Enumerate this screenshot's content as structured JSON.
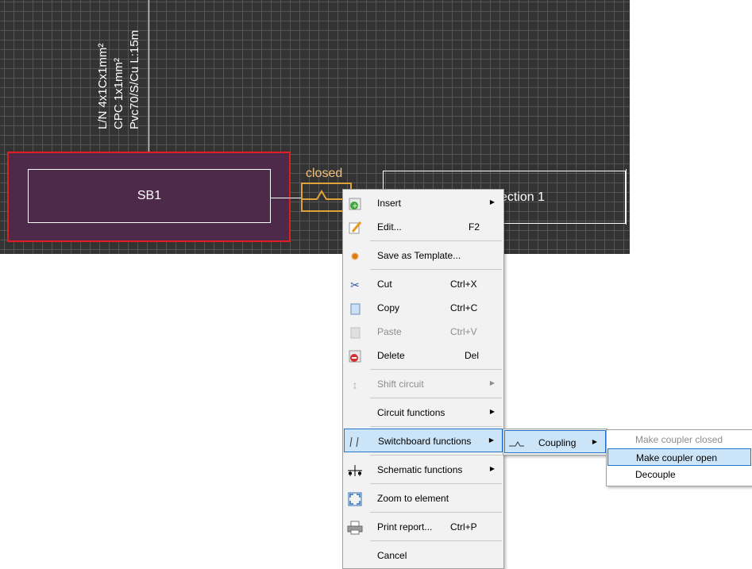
{
  "canvas": {
    "cable_lines": [
      "L/N 4x1Cx1mm²",
      "CPC  1x1mm²",
      "Pvc70/S/Cu L:15m"
    ],
    "switchboard_name": "SB1",
    "coupler_state": "closed",
    "section_name": "ection 1",
    "colors": {
      "background": "#333333",
      "grid": "#555555",
      "selection": "#e21e1e",
      "fill": "#4d2a4a",
      "coupler": "#e0a23a"
    }
  },
  "context_menu": {
    "items": [
      {
        "label": "Insert",
        "shortcut": "",
        "submenu": true,
        "disabled": false,
        "icon": "insert-icon"
      },
      {
        "label": "Edit...",
        "shortcut": "F2",
        "submenu": false,
        "disabled": false,
        "icon": "edit-icon"
      },
      {
        "label": "Save as Template...",
        "shortcut": "",
        "submenu": false,
        "disabled": false,
        "icon": "gear-icon"
      },
      {
        "label": "Cut",
        "shortcut": "Ctrl+X",
        "submenu": false,
        "disabled": false,
        "icon": "scissors-icon"
      },
      {
        "label": "Copy",
        "shortcut": "Ctrl+C",
        "submenu": false,
        "disabled": false,
        "icon": "copy-icon"
      },
      {
        "label": "Paste",
        "shortcut": "Ctrl+V",
        "submenu": false,
        "disabled": true,
        "icon": "paste-icon"
      },
      {
        "label": "Delete",
        "shortcut": "Del",
        "submenu": false,
        "disabled": false,
        "icon": "delete-icon"
      },
      {
        "label": "Shift circuit",
        "shortcut": "",
        "submenu": true,
        "disabled": true,
        "icon": "shift-icon"
      },
      {
        "label": "Circuit functions",
        "shortcut": "",
        "submenu": true,
        "disabled": false,
        "icon": ""
      },
      {
        "label": "Switchboard functions",
        "shortcut": "",
        "submenu": true,
        "disabled": false,
        "icon": "switch-icon"
      },
      {
        "label": "Schematic functions",
        "shortcut": "",
        "submenu": true,
        "disabled": false,
        "icon": "schematic-icon"
      },
      {
        "label": "Zoom to element",
        "shortcut": "",
        "submenu": false,
        "disabled": false,
        "icon": "zoom-fit-icon"
      },
      {
        "label": "Print report...",
        "shortcut": "Ctrl+P",
        "submenu": false,
        "disabled": false,
        "icon": "printer-icon"
      },
      {
        "label": "Cancel",
        "shortcut": "",
        "submenu": false,
        "disabled": false,
        "icon": ""
      }
    ]
  },
  "switchboard_submenu": {
    "label": "Coupling"
  },
  "coupling_submenu": {
    "items": [
      {
        "label": "Make coupler closed",
        "disabled": true
      },
      {
        "label": "Make coupler open",
        "disabled": false
      },
      {
        "label": "Decouple",
        "disabled": false
      }
    ]
  }
}
